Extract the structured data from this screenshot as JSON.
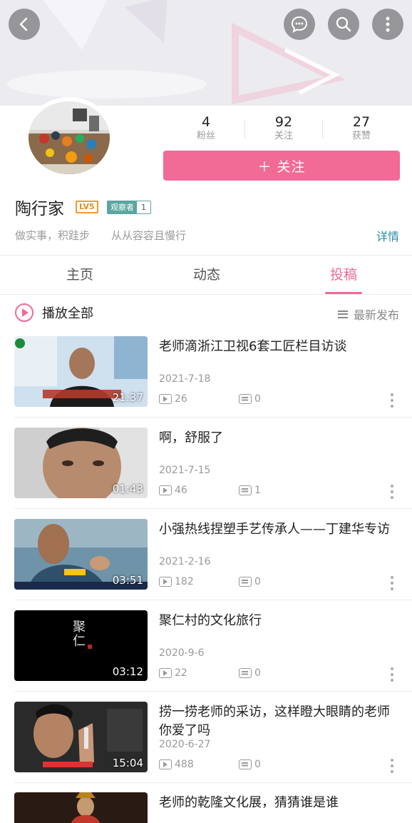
{
  "header": {
    "back_icon": "chevron-left-icon",
    "actions": [
      "message-icon",
      "search-icon",
      "more-vertical-icon"
    ]
  },
  "profile": {
    "name": "陶行家",
    "level_badge": "LV5",
    "role_badge": "观察者",
    "role_count": "1",
    "bio": "做实事，积跬步　　从从容容且慢行",
    "detail_link": "详情",
    "stats": [
      {
        "value": "4",
        "label": "粉丝"
      },
      {
        "value": "92",
        "label": "关注"
      },
      {
        "value": "27",
        "label": "获赞"
      }
    ],
    "follow_label": "＋ 关注"
  },
  "tabs": [
    {
      "label": "主页",
      "active": false
    },
    {
      "label": "动态",
      "active": false
    },
    {
      "label": "投稿",
      "active": true
    }
  ],
  "toolbar": {
    "play_all": "播放全部",
    "sort": "最新发布"
  },
  "videos": [
    {
      "title": "老师滴浙江卫视6套工匠栏目访谈",
      "date": "2021-7-18",
      "duration": "21:37",
      "plays": "26",
      "comments": "0"
    },
    {
      "title": "啊，舒服了",
      "date": "2021-7-15",
      "duration": "01:43",
      "plays": "46",
      "comments": "1"
    },
    {
      "title": "小强热线捏塑手艺传承人——丁建华专访",
      "date": "2021-2-16",
      "duration": "03:51",
      "plays": "182",
      "comments": "0"
    },
    {
      "title": "聚仁村的文化旅行",
      "date": "2020-9-6",
      "duration": "03:12",
      "plays": "22",
      "comments": "0"
    },
    {
      "title": "捞一捞老师的采访，这样瞪大眼睛的老师你爱了吗",
      "date": "2020-6-27",
      "duration": "15:04",
      "plays": "488",
      "comments": "0"
    },
    {
      "title": "老师的乾隆文化展，猜猜谁是谁",
      "date": "",
      "duration": "",
      "plays": "",
      "comments": ""
    }
  ],
  "thumb_texts": {
    "juren": "聚仁"
  },
  "colors": {
    "accent": "#f26a96",
    "link": "#2b8ea3",
    "level": "#f08a1b",
    "role": "#5aa6a0"
  }
}
